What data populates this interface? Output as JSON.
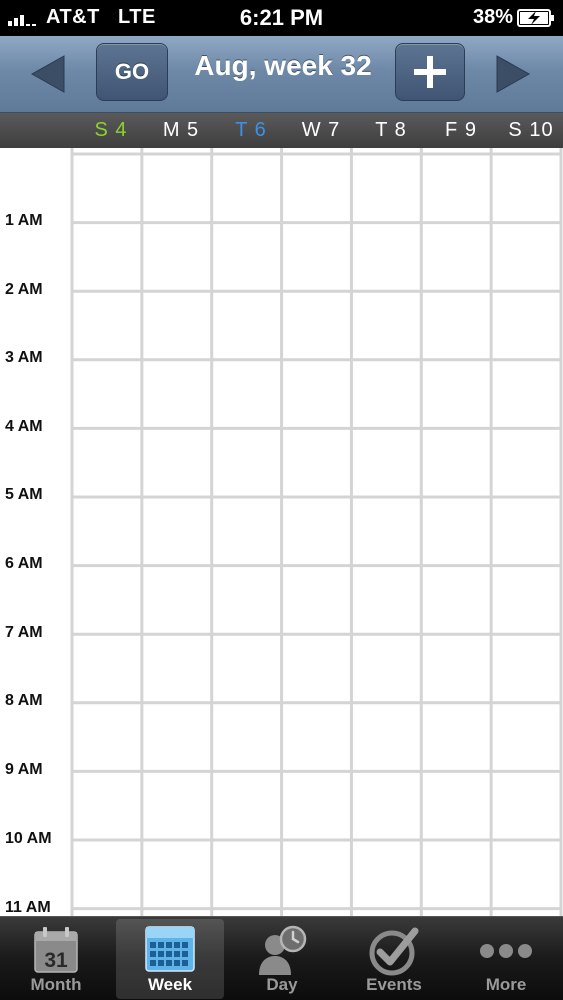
{
  "status_bar": {
    "carrier": "AT&T",
    "network": "LTE",
    "time": "6:21 PM",
    "battery": "38%"
  },
  "header": {
    "go_label": "GO",
    "title": "Aug, week 32",
    "prev_icon": "triangle-left",
    "next_icon": "triangle-right",
    "add_icon": "plus"
  },
  "days": [
    {
      "label": "S 4",
      "color": "#8ed22c"
    },
    {
      "label": "M 5",
      "color": "#ffffff"
    },
    {
      "label": "T 6",
      "color": "#3f8fe6"
    },
    {
      "label": "W 7",
      "color": "#ffffff"
    },
    {
      "label": "T 8",
      "color": "#ffffff"
    },
    {
      "label": "F 9",
      "color": "#ffffff"
    },
    {
      "label": "S 10",
      "color": "#ffffff"
    }
  ],
  "hours": [
    "1 AM",
    "2 AM",
    "3 AM",
    "4 AM",
    "5 AM",
    "6 AM",
    "7 AM",
    "8 AM",
    "9 AM",
    "10 AM",
    "11 AM"
  ],
  "tabs": [
    {
      "label": "Month",
      "icon": "calendar-31",
      "icon_text": "31",
      "active": false
    },
    {
      "label": "Week",
      "icon": "week-grid",
      "active": true
    },
    {
      "label": "Day",
      "icon": "person-clock",
      "active": false
    },
    {
      "label": "Events",
      "icon": "checkmark-badge",
      "active": false
    },
    {
      "label": "More",
      "icon": "ellipsis",
      "active": false
    }
  ],
  "colors": {
    "header_accent": "#6e89a8",
    "grid_line": "#d4d4d4",
    "sunday": "#8ed22c",
    "today": "#3f8fe6"
  }
}
